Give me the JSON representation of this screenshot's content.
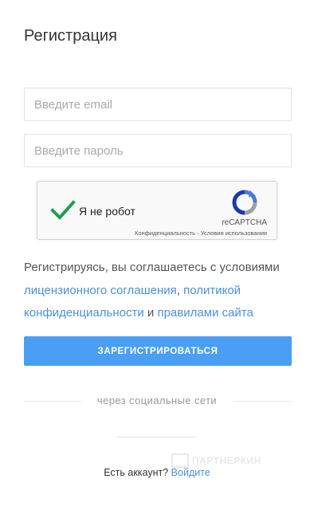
{
  "page": {
    "title": "Регистрация"
  },
  "form": {
    "email_placeholder": "Введите email",
    "email_value": "",
    "password_placeholder": "Введите пароль",
    "password_value": ""
  },
  "captcha": {
    "label": "Я не робот",
    "brand": "reCAPTCHA",
    "privacy": "Конфиденциальность",
    "separator": "-",
    "terms": "Условия использования",
    "checked": true,
    "check_color": "#1e9e4a"
  },
  "agreement": {
    "prefix": "Регистрируясь, вы соглашаетесь с условиями",
    "license_link": "лицензионного соглашения",
    "comma": ",",
    "policy_link": "политикой конфиденциальности",
    "and": "и",
    "rules_link": "правилами сайта"
  },
  "submit": {
    "label": "ЗАРЕГИСТРИРОВАТЬСЯ",
    "color": "#4a9ff5"
  },
  "social": {
    "label": "через социальные сети"
  },
  "watermark": {
    "text": "ПАРТНЕРКИН"
  },
  "login": {
    "prompt": "Есть аккаунт?",
    "link": "Войдите"
  },
  "colors": {
    "link": "#4a90e2",
    "text": "#555555"
  }
}
